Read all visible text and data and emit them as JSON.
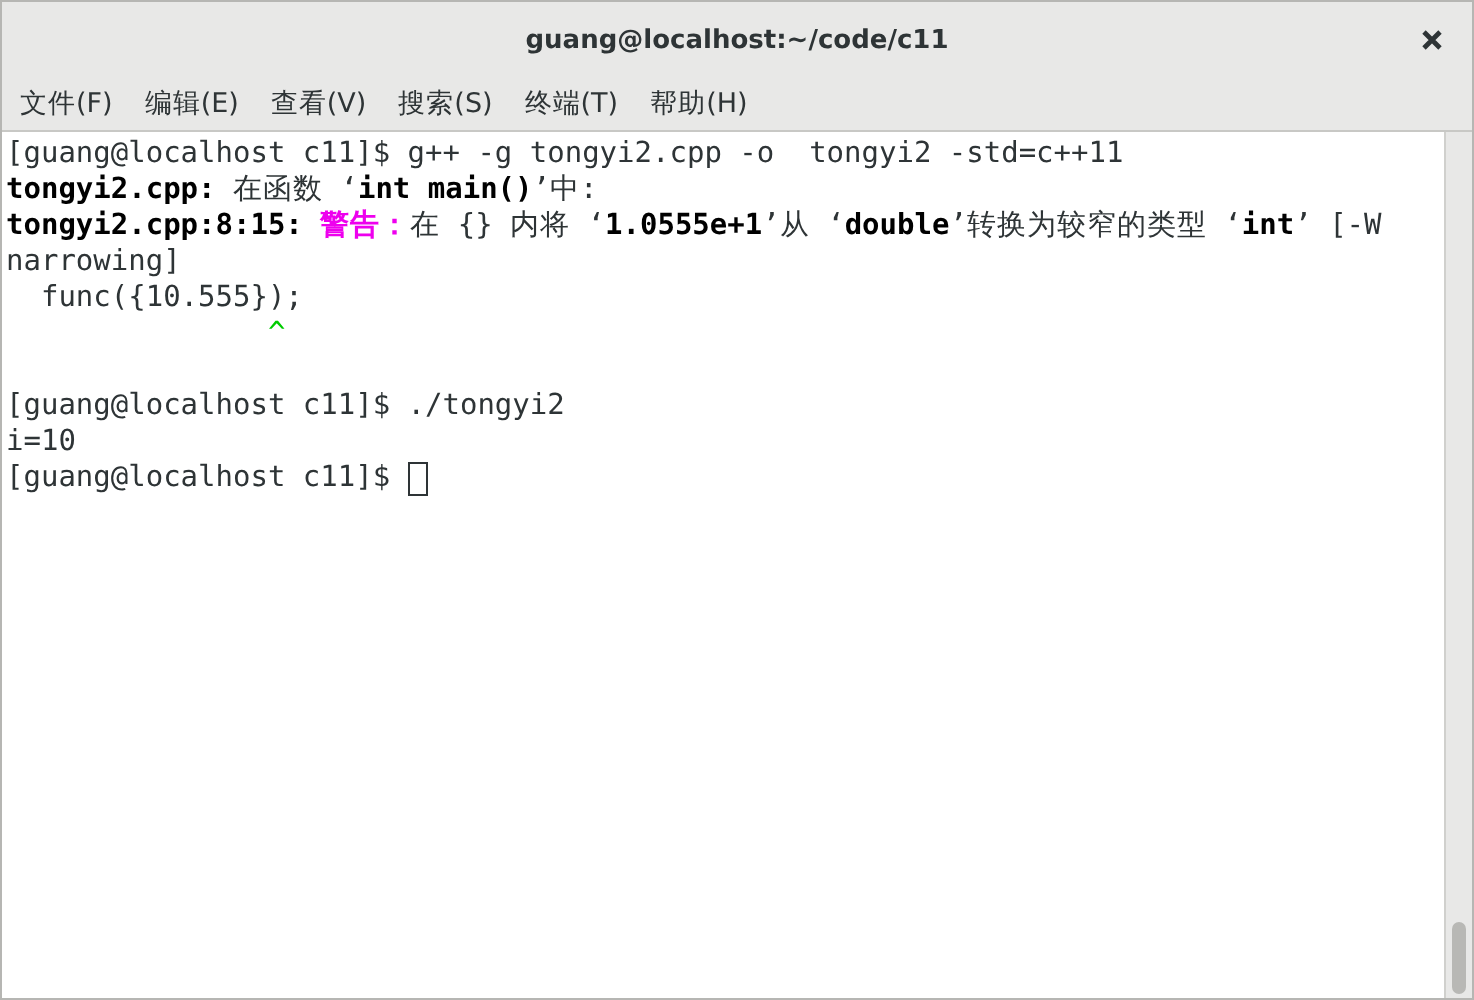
{
  "window": {
    "title": "guang@localhost:~/code/c11"
  },
  "menu": [
    "文件(F)",
    "编辑(E)",
    "查看(V)",
    "搜索(S)",
    "终端(T)",
    "帮助(H)"
  ],
  "terminal": {
    "lines": [
      [
        {
          "kind": "normal",
          "text": "[guang@localhost c11]$ g++ -g tongyi2.cpp -o  tongyi2 -std=c++11"
        }
      ],
      [
        {
          "kind": "bold",
          "text": "tongyi2.cpp:"
        },
        {
          "kind": "normal",
          "text": " 在函数 ‘"
        },
        {
          "kind": "bold",
          "text": "int main()"
        },
        {
          "kind": "normal",
          "text": "’中:"
        }
      ],
      [
        {
          "kind": "bold",
          "text": "tongyi2.cpp:8:15: "
        },
        {
          "kind": "warning",
          "text": "警告："
        },
        {
          "kind": "normal",
          "text": "在 {} 内将 ‘"
        },
        {
          "kind": "bold",
          "text": "1.0555e+1"
        },
        {
          "kind": "normal",
          "text": "’从 ‘"
        },
        {
          "kind": "bold",
          "text": "double"
        },
        {
          "kind": "normal",
          "text": "’转换为较窄的类型 ‘"
        },
        {
          "kind": "bold",
          "text": "int"
        },
        {
          "kind": "normal",
          "text": "’ [-W"
        }
      ],
      [
        {
          "kind": "normal",
          "text": "narrowing]"
        }
      ],
      [
        {
          "kind": "normal",
          "text": "  func({10.555});"
        }
      ],
      [
        {
          "kind": "caret",
          "text": "               ^"
        }
      ],
      [
        {
          "kind": "blank"
        }
      ],
      [
        {
          "kind": "normal",
          "text": "[guang@localhost c11]$ ./tongyi2"
        }
      ],
      [
        {
          "kind": "normal",
          "text": "i=10"
        }
      ],
      [
        {
          "kind": "normal",
          "text": "[guang@localhost c11]$ "
        },
        {
          "kind": "cursor"
        }
      ]
    ]
  }
}
